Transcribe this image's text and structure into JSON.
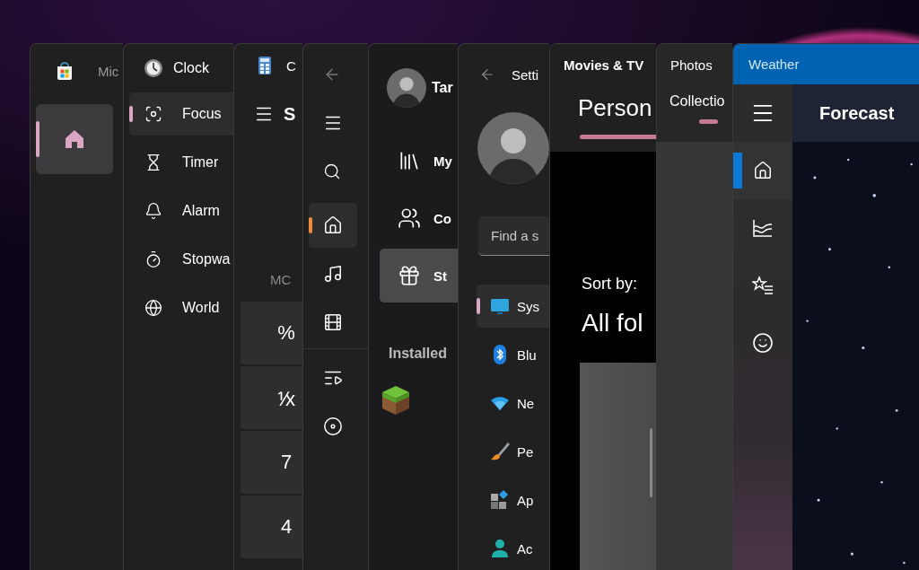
{
  "windows": [
    {
      "kind": "store",
      "title": "Mic",
      "nav": [
        {
          "selected": true
        }
      ]
    },
    {
      "kind": "clock",
      "title": "Clock",
      "nav": [
        {
          "label": "Focus",
          "selected": true
        },
        {
          "label": "Timer",
          "selected": false
        },
        {
          "label": "Alarm",
          "selected": false
        },
        {
          "label": "Stopwa",
          "selected": false
        },
        {
          "label": "World",
          "selected": false
        }
      ]
    },
    {
      "kind": "calculator",
      "title": "C",
      "mode": "S",
      "memory": "MC",
      "keys": [
        "%",
        "⅟x",
        "7",
        "4"
      ]
    },
    {
      "kind": "media_player",
      "nav": [
        {
          "selected": true
        },
        {
          "selected": false
        },
        {
          "selected": false
        },
        {
          "selected": false
        },
        {
          "selected": false
        }
      ]
    },
    {
      "kind": "xbox",
      "user": "Tar",
      "nav": [
        {
          "label": "My",
          "selected": false
        },
        {
          "label": "Co",
          "selected": false
        },
        {
          "label": "St",
          "selected": true
        }
      ],
      "section": "Installed"
    },
    {
      "kind": "settings",
      "title": "Setti",
      "search": {
        "placeholder": "Find a s"
      },
      "nav": [
        {
          "label": "Sys",
          "selected": true
        },
        {
          "label": "Blu",
          "selected": false
        },
        {
          "label": "Ne",
          "selected": false
        },
        {
          "label": "Pe",
          "selected": false
        },
        {
          "label": "Ap",
          "selected": false
        },
        {
          "label": "Ac",
          "selected": false
        }
      ]
    },
    {
      "kind": "movies",
      "title": "Movies & TV",
      "tabs": [
        {
          "label": "Person",
          "selected": true
        }
      ],
      "sort_label": "Sort by:",
      "heading": "All fol"
    },
    {
      "kind": "photos",
      "title": "Photos",
      "tabs": [
        {
          "label": "Collectio",
          "selected": true
        }
      ]
    },
    {
      "kind": "weather",
      "title": "Weather",
      "heading": "Forecast",
      "nav": [
        {
          "selected": true
        },
        {
          "selected": false
        },
        {
          "selected": false
        },
        {
          "selected": false
        }
      ]
    }
  ]
}
